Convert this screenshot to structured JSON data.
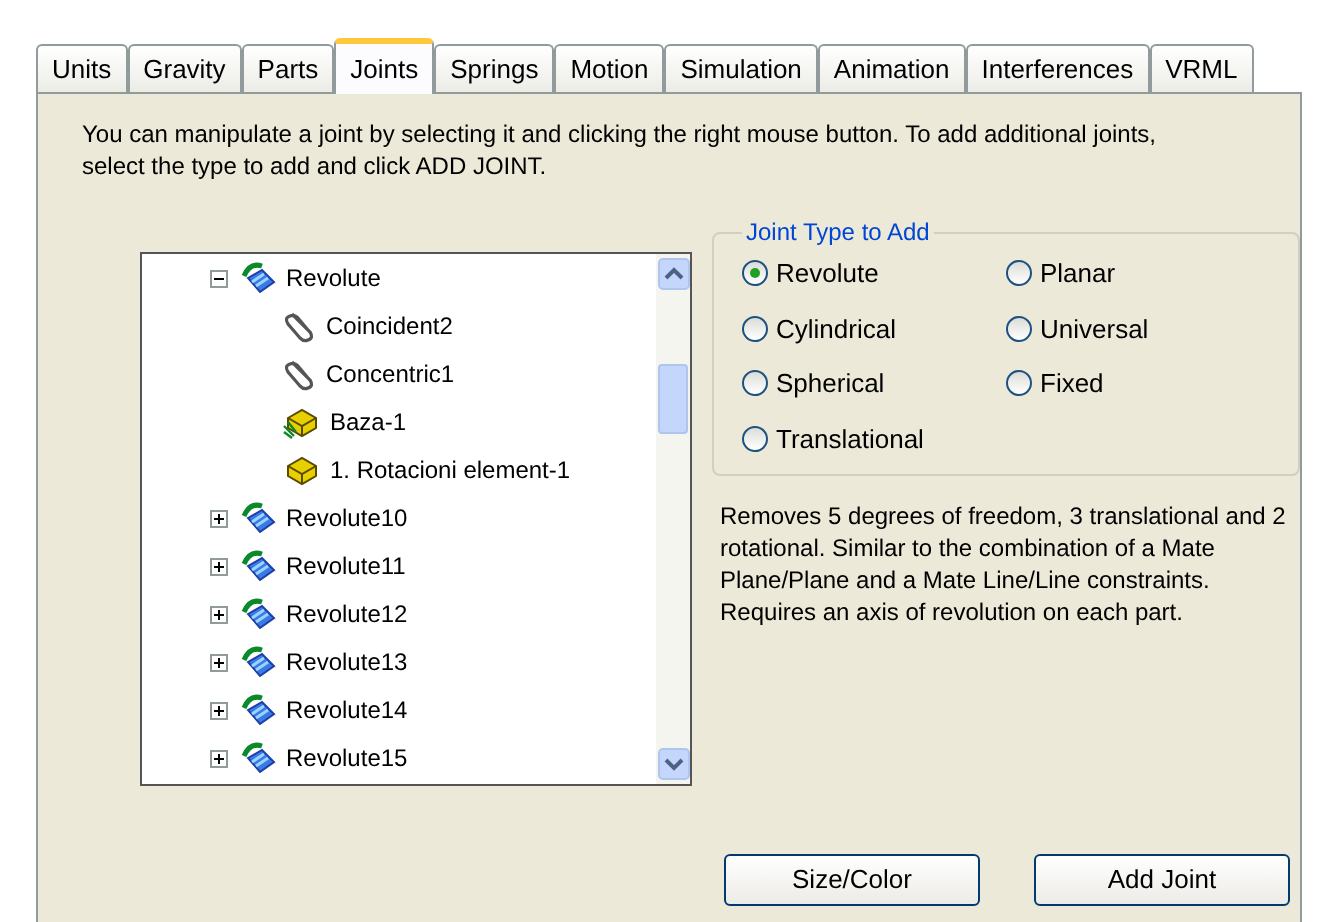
{
  "tabs": [
    {
      "label": "Units",
      "selected": false
    },
    {
      "label": "Gravity",
      "selected": false
    },
    {
      "label": "Parts",
      "selected": false
    },
    {
      "label": "Joints",
      "selected": true
    },
    {
      "label": "Springs",
      "selected": false
    },
    {
      "label": "Motion",
      "selected": false
    },
    {
      "label": "Simulation",
      "selected": false
    },
    {
      "label": "Animation",
      "selected": false
    },
    {
      "label": "Interferences",
      "selected": false
    },
    {
      "label": "VRML",
      "selected": false
    }
  ],
  "instructions": "You can manipulate a joint by selecting it and clicking the right mouse button. To add additional joints, select the type to add and click ADD JOINT.",
  "tree": [
    {
      "label": "Revolute",
      "kind": "joint",
      "expanded": true,
      "children": [
        {
          "label": "Coincident2",
          "kind": "mate"
        },
        {
          "label": "Concentric1",
          "kind": "mate"
        },
        {
          "label": "Baza-1",
          "kind": "fixed-part"
        },
        {
          "label": "1. Rotacioni element-1",
          "kind": "part"
        }
      ]
    },
    {
      "label": "Revolute10",
      "kind": "joint",
      "expanded": false
    },
    {
      "label": "Revolute11",
      "kind": "joint",
      "expanded": false
    },
    {
      "label": "Revolute12",
      "kind": "joint",
      "expanded": false
    },
    {
      "label": "Revolute13",
      "kind": "joint",
      "expanded": false
    },
    {
      "label": "Revolute14",
      "kind": "joint",
      "expanded": false
    },
    {
      "label": "Revolute15",
      "kind": "joint",
      "expanded": false
    }
  ],
  "joint_type": {
    "title": "Joint Type to Add",
    "options": [
      {
        "label": "Revolute",
        "selected": true
      },
      {
        "label": "Planar",
        "selected": false
      },
      {
        "label": "Cylindrical",
        "selected": false
      },
      {
        "label": "Universal",
        "selected": false
      },
      {
        "label": "Spherical",
        "selected": false
      },
      {
        "label": "Fixed",
        "selected": false
      },
      {
        "label": "Translational",
        "selected": false
      }
    ]
  },
  "description": "Removes 5 degrees of freedom, 3 translational and 2 rotational. Similar to the combination of a Mate Plane/Plane and a Mate Line/Line constraints. Requires an axis of revolution on each part.",
  "buttons": [
    "Size/Color",
    "Add Joint"
  ]
}
